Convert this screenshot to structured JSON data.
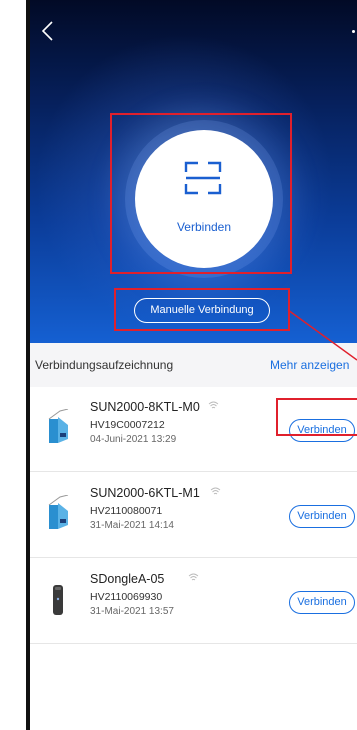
{
  "hero": {
    "connect_label": "Verbinden",
    "manual_connect_label": "Manuelle Verbindung"
  },
  "records": {
    "title": "Verbindungsaufzeichnung",
    "more_label": "Mehr anzeigen",
    "items": [
      {
        "name": "SUN2000-8KTL-M0",
        "sn": "HV19C0007212",
        "date": "04-Juni-2021 13:29",
        "button": "Verbinden",
        "icon": "inverter-icon"
      },
      {
        "name": "SUN2000-6KTL-M1",
        "sn": "HV2110080071",
        "date": "31-Mai-2021 14:14",
        "button": "Verbinden",
        "icon": "inverter-icon"
      },
      {
        "name": "SDongleA-05",
        "sn": "HV2110069930",
        "date": "31-Mai-2021 13:57",
        "button": "Verbinden",
        "icon": "dongle-icon"
      }
    ]
  },
  "colors": {
    "accent": "#1a6fe0",
    "hero_top": "#020a26",
    "hero_bottom": "#1560d2",
    "highlight": "#e0202c"
  }
}
